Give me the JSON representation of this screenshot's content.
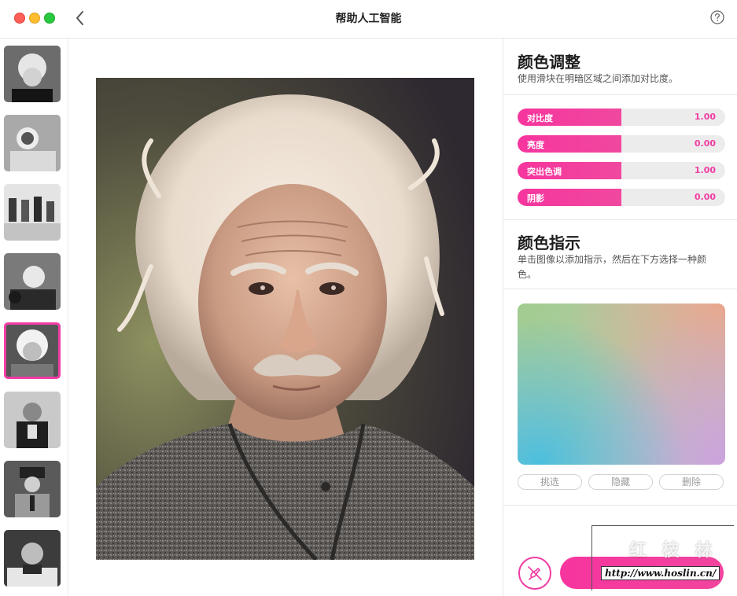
{
  "window": {
    "title": "帮助人工智能",
    "back_icon": "chevron-left-icon",
    "help_icon": "question-circle-icon"
  },
  "thumbnails": [
    {
      "name": "thumb-1",
      "selected": false
    },
    {
      "name": "thumb-2",
      "selected": false
    },
    {
      "name": "thumb-3",
      "selected": false
    },
    {
      "name": "thumb-4",
      "selected": false
    },
    {
      "name": "thumb-5",
      "selected": true
    },
    {
      "name": "thumb-6",
      "selected": false
    },
    {
      "name": "thumb-7",
      "selected": false
    },
    {
      "name": "thumb-8",
      "selected": false
    }
  ],
  "panel": {
    "adjust_title": "颜色调整",
    "adjust_desc": "使用滑块在明暗区域之间添加对比度。",
    "sliders": [
      {
        "label": "对比度",
        "value": "1.00",
        "fill_fraction": 0.5
      },
      {
        "label": "亮度",
        "value": "0.00",
        "fill_fraction": 0.5
      },
      {
        "label": "突出色调",
        "value": "1.00",
        "fill_fraction": 0.5
      },
      {
        "label": "阴影",
        "value": "0.00",
        "fill_fraction": 0.5
      }
    ],
    "hint_title": "颜色指示",
    "hint_desc": "单击图像以添加指示，然后在下方选择一种颜色。",
    "buttons": {
      "pick": "挑选",
      "hide": "隐藏",
      "delete": "删除"
    },
    "brush_icon": "brush-off-icon"
  },
  "watermark": {
    "logo": "红 枝 林",
    "url": "http://www.hoslin.cn/"
  },
  "colors": {
    "accent": "#f03da3"
  }
}
